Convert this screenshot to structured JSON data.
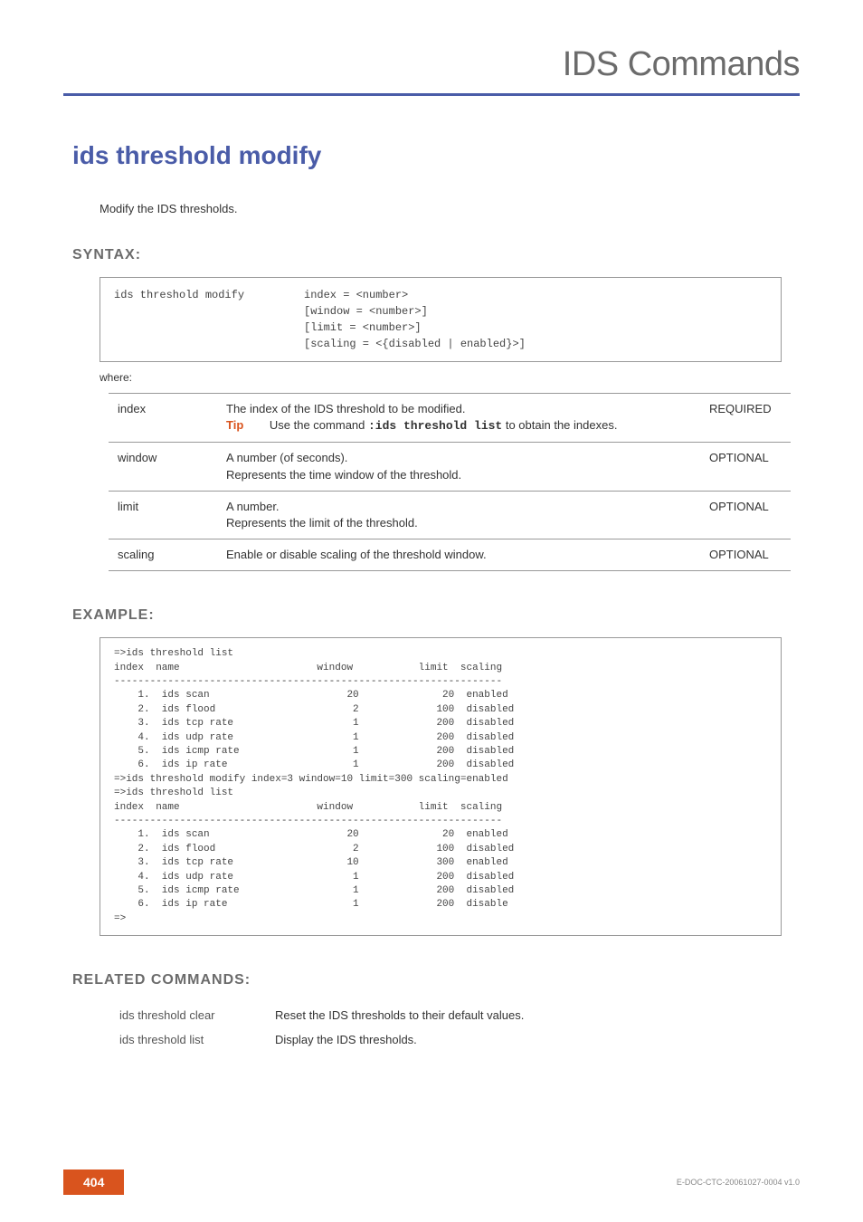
{
  "chapter": "IDS Commands",
  "title": "ids threshold modify",
  "intro": "Modify the IDS thresholds.",
  "sections": {
    "syntax": "SYNTAX:",
    "example": "EXAMPLE:",
    "related": "RELATED COMMANDS:"
  },
  "syntax": {
    "cmd": "ids threshold modify",
    "arg1": "index = <number>",
    "arg2": "[window = <number>]",
    "arg3": "[limit = <number>]",
    "arg4": "[scaling = <{disabled | enabled}>]"
  },
  "where": "where:",
  "params": [
    {
      "name": "index",
      "desc": "The index of the IDS threshold to be modified.",
      "tip_label": "Tip",
      "tip_pre": "Use the command ",
      "tip_code": ":ids threshold list",
      "tip_post": " to obtain the indexes.",
      "req": "REQUIRED"
    },
    {
      "name": "window",
      "desc1": "A number (of seconds).",
      "desc2": "Represents the time window of the threshold.",
      "req": "OPTIONAL"
    },
    {
      "name": "limit",
      "desc1": "A number.",
      "desc2": "Represents the limit of the threshold.",
      "req": "OPTIONAL"
    },
    {
      "name": "scaling",
      "desc1": "Enable or disable scaling of the threshold window.",
      "req": "OPTIONAL"
    }
  ],
  "example": "=>ids threshold list\nindex  name                       window           limit  scaling\n-----------------------------------------------------------------\n    1.  ids scan                       20              20  enabled\n    2.  ids flood                       2             100  disabled\n    3.  ids tcp rate                    1             200  disabled\n    4.  ids udp rate                    1             200  disabled\n    5.  ids icmp rate                   1             200  disabled\n    6.  ids ip rate                     1             200  disabled\n=>ids threshold modify index=3 window=10 limit=300 scaling=enabled\n=>ids threshold list\nindex  name                       window           limit  scaling\n-----------------------------------------------------------------\n    1.  ids scan                       20              20  enabled\n    2.  ids flood                       2             100  disabled\n    3.  ids tcp rate                   10             300  enabled\n    4.  ids udp rate                    1             200  disabled\n    5.  ids icmp rate                   1             200  disabled\n    6.  ids ip rate                     1             200  disable\n=>",
  "related": [
    {
      "cmd": "ids threshold clear",
      "desc": "Reset the IDS thresholds to their default values."
    },
    {
      "cmd": "ids threshold list",
      "desc": "Display the IDS thresholds."
    }
  ],
  "footer": {
    "page": "404",
    "docid": "E-DOC-CTC-20061027-0004 v1.0"
  }
}
